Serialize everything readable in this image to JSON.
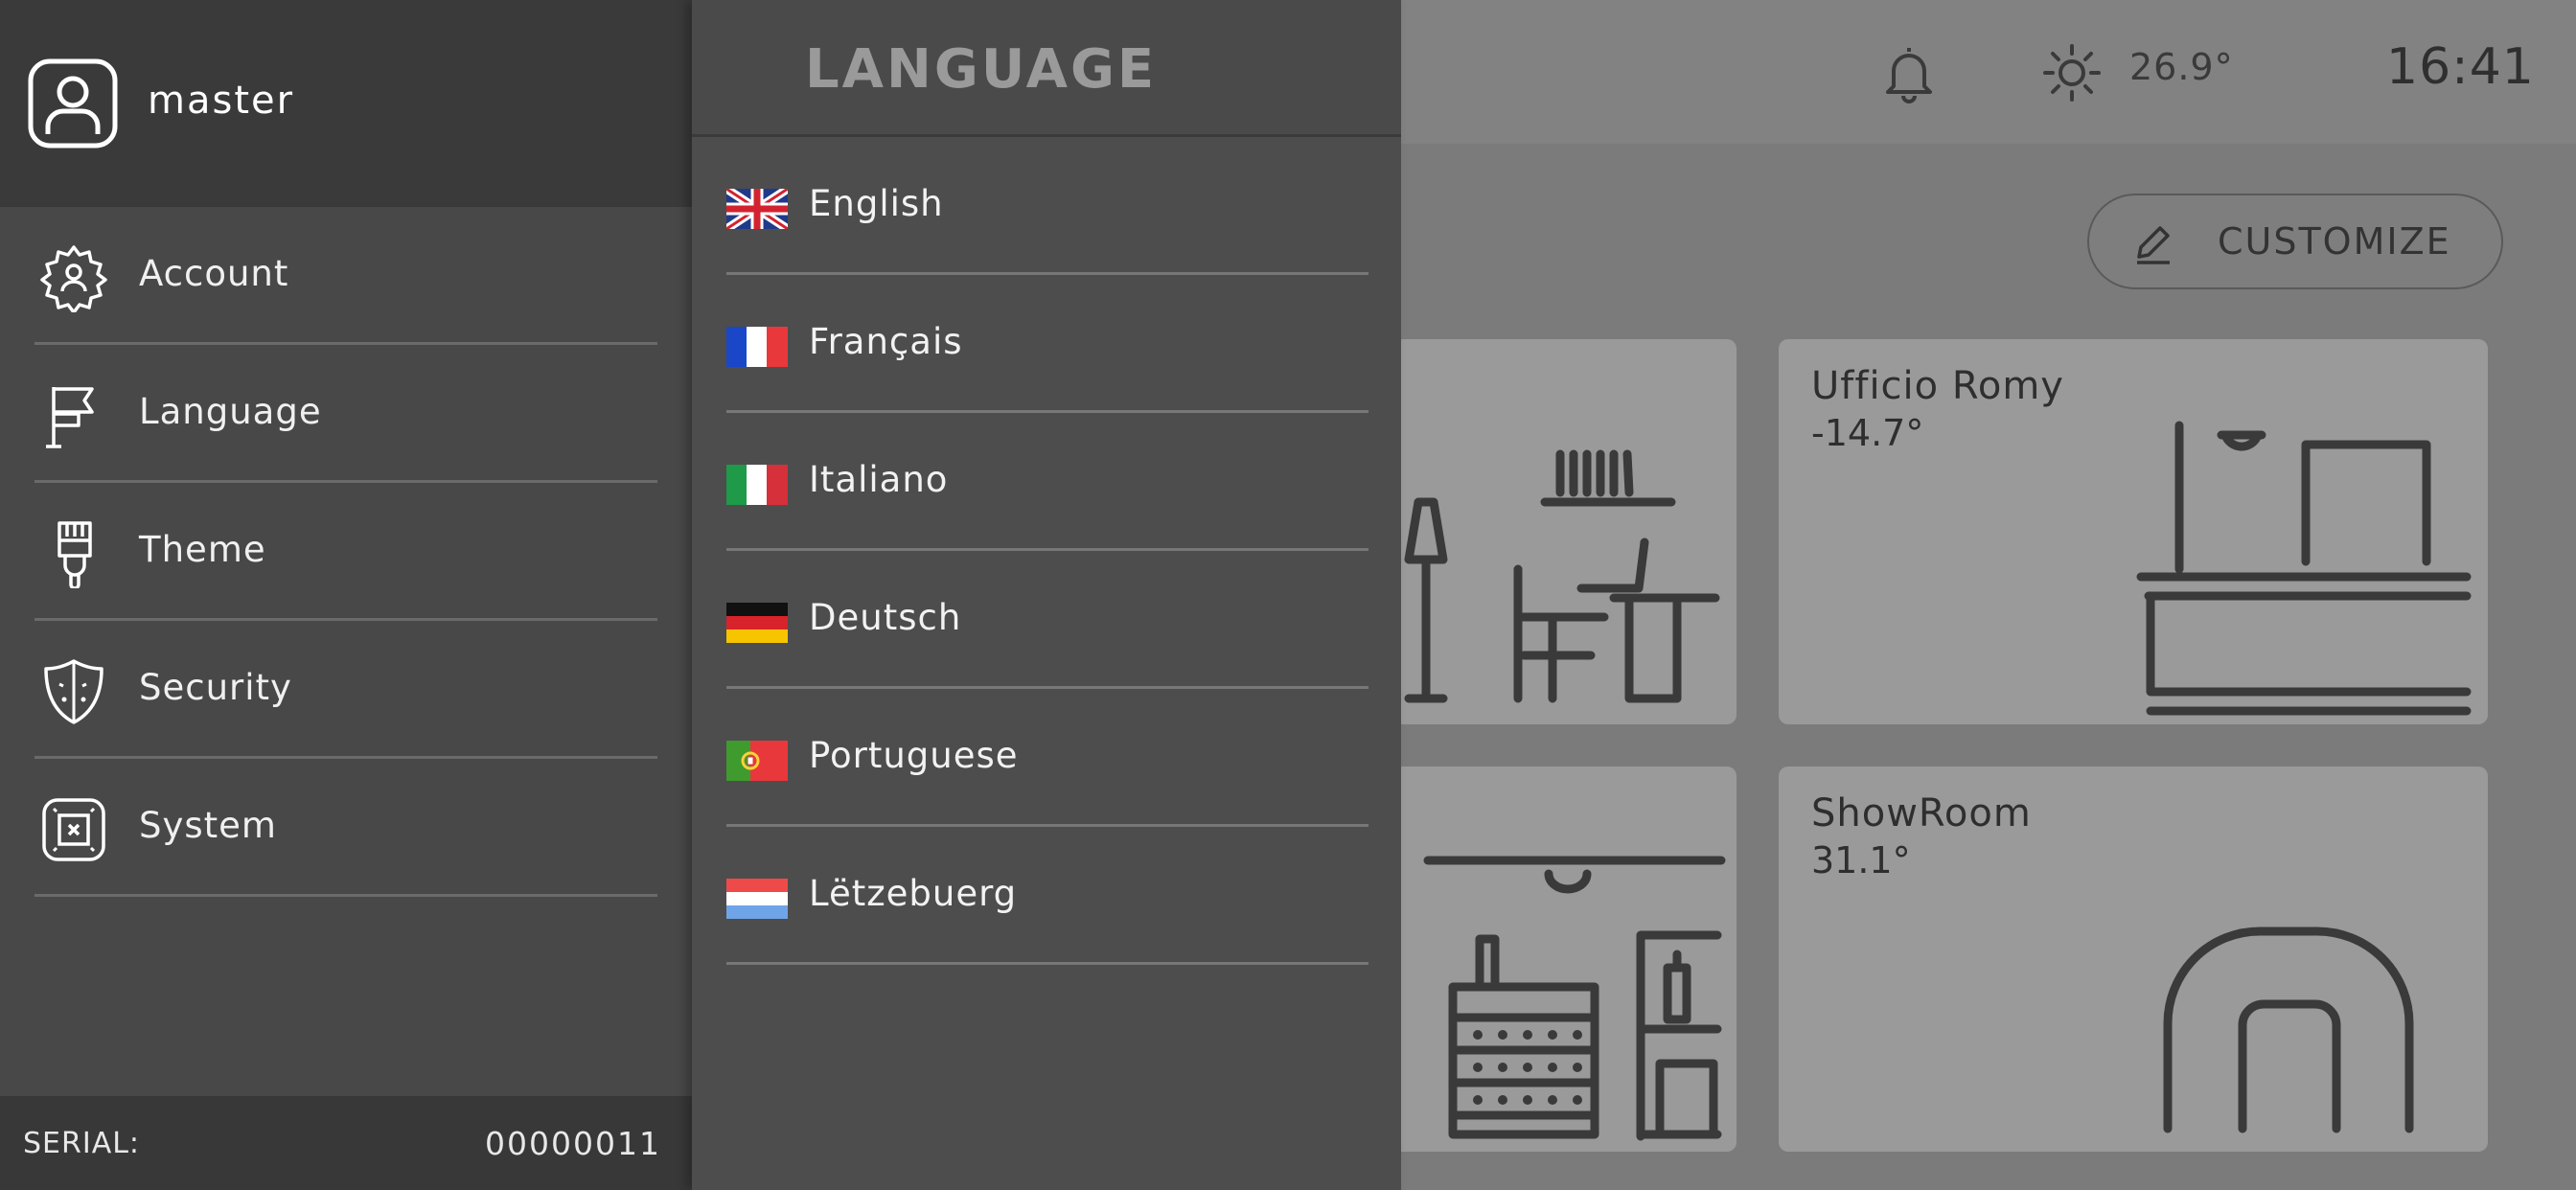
{
  "header": {
    "temperature": "26.9°",
    "time": "16:41"
  },
  "customize_label": "CUSTOMIZE",
  "rooms": [
    {
      "name": "Ufficio Romy",
      "temperature": "-14.7°"
    },
    {
      "name": "ShowRoom",
      "temperature": "31.1°"
    }
  ],
  "user": {
    "name": "master"
  },
  "sidebar": {
    "items": [
      {
        "label": "Account",
        "icon": "gear-user-icon"
      },
      {
        "label": "Language",
        "icon": "flag-icon"
      },
      {
        "label": "Theme",
        "icon": "brush-icon"
      },
      {
        "label": "Security",
        "icon": "shield-icon"
      },
      {
        "label": "System",
        "icon": "system-chip-icon"
      }
    ]
  },
  "footer": {
    "serial_label": "SERIAL:",
    "serial_value": "00000011"
  },
  "language_panel": {
    "title": "LANGUAGE",
    "items": [
      {
        "label": "English",
        "flag": "uk-flag-icon"
      },
      {
        "label": "Français",
        "flag": "france-flag-icon"
      },
      {
        "label": "Italiano",
        "flag": "italy-flag-icon"
      },
      {
        "label": "Deutsch",
        "flag": "germany-flag-icon"
      },
      {
        "label": "Portuguese",
        "flag": "portugal-flag-icon"
      },
      {
        "label": "Lëtzebuerg",
        "flag": "luxembourg-flag-icon"
      }
    ]
  },
  "colors": {
    "sidebar_bg": "#484848",
    "sidebar_header_bg": "#3a3a3a",
    "panel_bg": "#4d4d4d",
    "overlay_bg": "#7b7b7b",
    "card_bg": "#9a9a9a"
  }
}
